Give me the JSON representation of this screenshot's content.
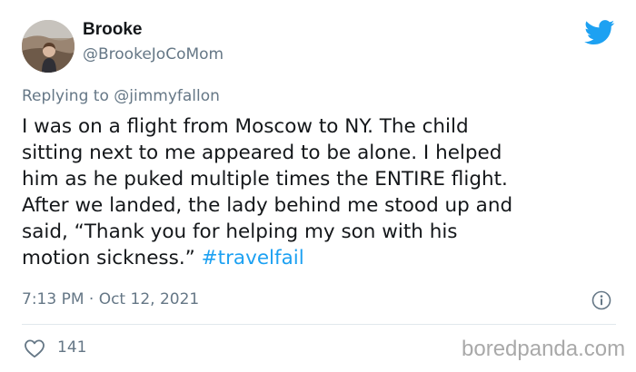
{
  "author": {
    "name": "Brooke",
    "handle": "@BrookeJoCoMom"
  },
  "reply": {
    "prefix": "Replying to",
    "mention": "@jimmyfallon"
  },
  "tweet": {
    "text": "I was on a flight from Moscow to NY. The child\nsitting next to me appeared to be alone. I helped\nhim as he puked multiple times the ENTIRE flight.\nAfter we landed, the lady behind me stood up and\nsaid, “Thank you for helping my son with his\nmotion sickness.” ",
    "hashtag": "#travelfail"
  },
  "meta": {
    "timestamp": "7:13 PM · Oct 12, 2021"
  },
  "stats": {
    "likes": "141"
  },
  "watermark": "boredpanda.com",
  "icons": {
    "brand": "twitter-bird-icon",
    "info": "info-icon",
    "like": "heart-icon"
  },
  "colors": {
    "twitter_blue": "#1da1f2",
    "text": "#14171a",
    "secondary": "#657786",
    "divider": "#e1e8ed"
  }
}
